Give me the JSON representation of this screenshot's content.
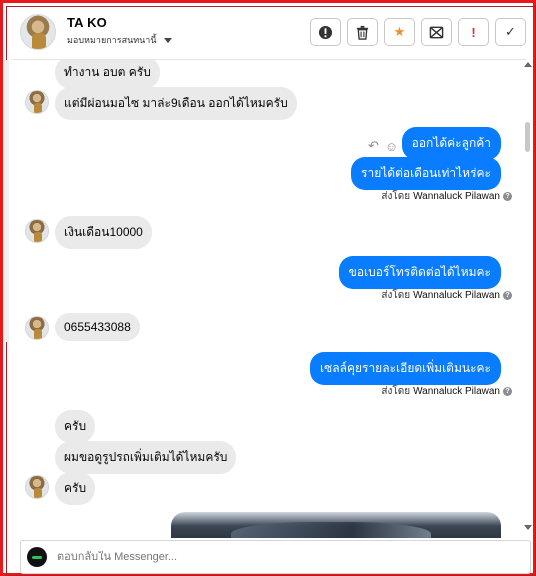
{
  "header": {
    "name": "TA KO",
    "assign_label": "มอบหมายการสนทนานี้",
    "tools": [
      {
        "icon": "alert-circle-icon",
        "label": ""
      },
      {
        "icon": "trash-icon",
        "label": ""
      },
      {
        "icon": "star-icon",
        "label": "★"
      },
      {
        "icon": "mail-x-icon",
        "label": ""
      },
      {
        "icon": "exclamation-icon",
        "label": "!"
      },
      {
        "icon": "check-icon",
        "label": "✓"
      }
    ]
  },
  "messages": {
    "in_1": "ทำงาน อบต ครับ",
    "in_2": "แต่มีผ่อนมอไซ มาล่ะ9เดือน ออกได้ไหมครับ",
    "out_1": "ออกได้ค่ะลูกค้า",
    "out_2": "รายได้ต่อเดือนเท่าไหร่คะ",
    "in_3": "เงินเดือน10000",
    "out_3": "ขอเบอร์โทรติดต่อได้ไหมคะ",
    "in_4": "0655433088",
    "out_4": "เซลล์คุยรายละเอียดเพิ่มเติมนะคะ",
    "in_5": "ครับ",
    "in_6": "ผมขอดูรูปรถเพิ่มเติมได้ไหมครับ",
    "in_7": "ครับ"
  },
  "sent_by": {
    "prefix": "ส่งโดย",
    "name": "Wannaluck Pilawan",
    "help": "?"
  },
  "composer": {
    "placeholder": "ตอบกลับใน Messenger..."
  },
  "colors": {
    "frame": "#e8181b",
    "outgoing": "#0a7cff",
    "incoming": "#eaeaea"
  }
}
